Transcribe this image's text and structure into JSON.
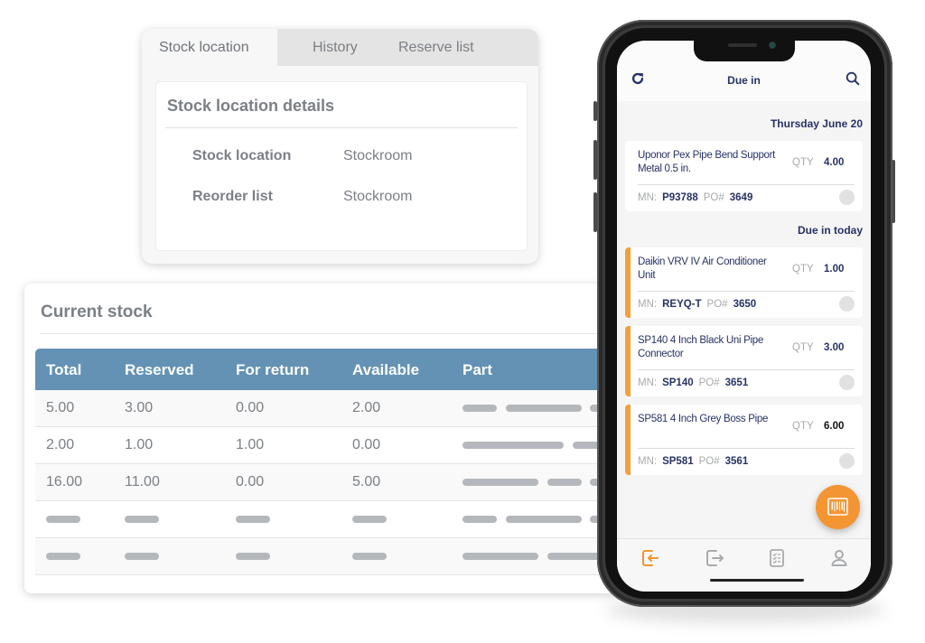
{
  "location_panel": {
    "tabs": [
      {
        "label": "Stock location",
        "active": true
      },
      {
        "label": "History",
        "active": false
      },
      {
        "label": "Reserve list",
        "active": false
      }
    ],
    "card_title": "Stock location details",
    "rows": [
      {
        "label": "Stock location",
        "value": "Stockroom"
      },
      {
        "label": "Reorder list",
        "value": "Stockroom"
      }
    ]
  },
  "stock_panel": {
    "title": "Current stock",
    "columns": [
      "Total",
      "Reserved",
      "For return",
      "Available",
      "Part"
    ],
    "rows": [
      {
        "total": "5.00",
        "reserved": "3.00",
        "for_return": "0.00",
        "available": "2.00"
      },
      {
        "total": "2.00",
        "reserved": "1.00",
        "for_return": "1.00",
        "available": "0.00"
      },
      {
        "total": "16.00",
        "reserved": "11.00",
        "for_return": "0.00",
        "available": "5.00"
      }
    ],
    "header_color": "#6392b4"
  },
  "phone": {
    "app_bar": {
      "title": "Due in",
      "left_icon": "refresh-icon",
      "right_icon": "search-icon"
    },
    "sections": [
      {
        "heading": "Thursday June 20",
        "items": [
          {
            "name": "Uponor Pex Pipe Bend Support Metal 0.5 in.",
            "qty_label": "QTY",
            "qty": "4.00",
            "mn_label": "MN:",
            "mn": "P93788",
            "po_label": "PO#",
            "po": "3649",
            "flagged": false
          }
        ]
      },
      {
        "heading": "Due in today",
        "items": [
          {
            "name": "Daikin VRV IV Air Conditioner Unit",
            "qty_label": "QTY",
            "qty": "1.00",
            "mn_label": "MN:",
            "mn": "REYQ-T",
            "po_label": "PO#",
            "po": "3650",
            "flagged": true
          },
          {
            "name": "SP140 4 Inch Black Uni Pipe Connector",
            "qty_label": "QTY",
            "qty": "3.00",
            "mn_label": "MN:",
            "mn": "SP140",
            "po_label": "PO#",
            "po": "3651",
            "flagged": true
          },
          {
            "name": "SP581 4 Inch Grey Boss Pipe",
            "qty_label": "QTY",
            "qty": "6.00",
            "mn_label": "MN:",
            "mn": "SP581",
            "po_label": "PO#",
            "po": "3561",
            "flagged": true
          }
        ]
      }
    ],
    "fab_icon": "barcode-scan-icon",
    "bottom_nav": [
      {
        "icon": "due-in-icon",
        "active": true
      },
      {
        "icon": "due-out-icon",
        "active": false
      },
      {
        "icon": "checklist-icon",
        "active": false
      },
      {
        "icon": "profile-icon",
        "active": false
      }
    ],
    "colors": {
      "accent": "#f39533",
      "primary_text": "#273266",
      "muted": "#a7a9ab"
    }
  }
}
